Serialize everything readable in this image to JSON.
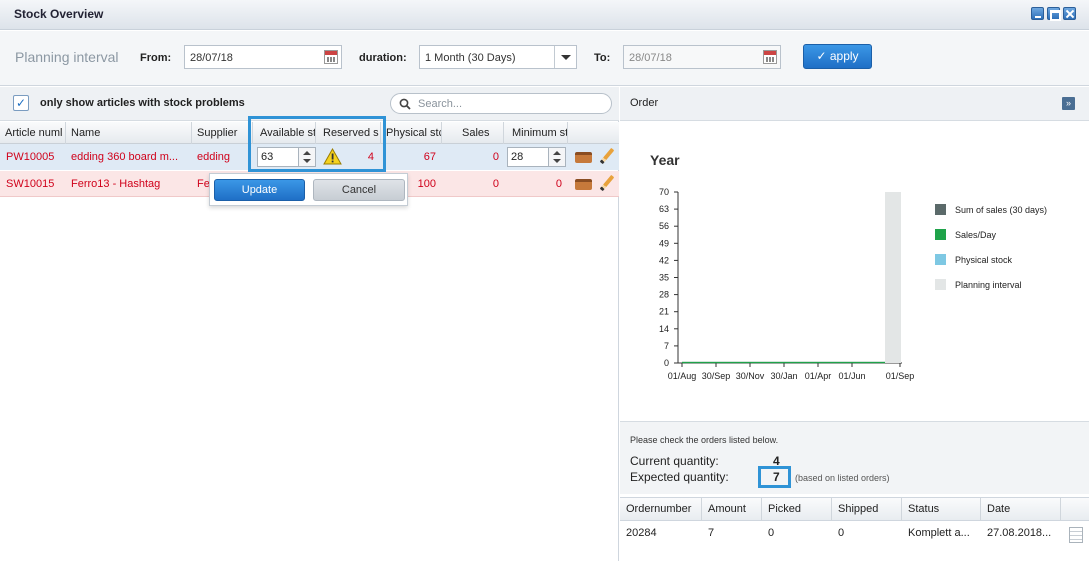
{
  "window": {
    "title": "Stock Overview"
  },
  "planning": {
    "label": "Planning interval",
    "from_label": "From:",
    "from_value": "28/07/18",
    "duration_label": "duration:",
    "duration_value": "1 Month (30 Days)",
    "to_label": "To:",
    "to_value": "28/07/18",
    "apply_label": "✓ apply"
  },
  "filter": {
    "checkbox_label": "only show articles with stock problems",
    "checked": true,
    "search_placeholder": "Search..."
  },
  "grid": {
    "columns": [
      "Article numl",
      "Name",
      "Supplier",
      "Available st",
      "Reserved s",
      "Physical stc",
      "Sales",
      "Minimum st"
    ],
    "rows": [
      {
        "article": "PW10005",
        "name": "edding 360 board m...",
        "supplier": "edding",
        "available": "63",
        "reserved": "4",
        "physical": "67",
        "sales": "0",
        "minimum": "28"
      },
      {
        "article": "SW10015",
        "name": "Ferro13 - Hashtag",
        "supplier": "Fe",
        "available": "",
        "reserved": "",
        "physical": "100",
        "sales": "0",
        "minimum": "0"
      }
    ],
    "update_label": "Update",
    "cancel_label": "Cancel"
  },
  "order_panel": {
    "title": "Order",
    "expand_glyph": "»",
    "chart_title": "Year"
  },
  "chart_data": {
    "type": "bar",
    "title": "Year",
    "xlabel": "",
    "ylabel": "",
    "ylim": [
      0,
      70
    ],
    "yticks": [
      "70",
      "63",
      "56",
      "49",
      "42",
      "35",
      "28",
      "21",
      "14",
      "7",
      "0"
    ],
    "xticks": [
      "01/Aug",
      "30/Sep",
      "30/Nov",
      "30/Jan",
      "01/Apr",
      "01/Jun",
      "01/Sep"
    ],
    "series": [
      {
        "name": "Sum of sales (30 days)",
        "color": "#5b6a6a",
        "values": [
          0,
          0,
          0,
          0,
          0,
          0,
          0
        ]
      },
      {
        "name": "Sales/Day",
        "color": "#1fa34a",
        "values": [
          0,
          0,
          0,
          0,
          0,
          0,
          0
        ]
      },
      {
        "name": "Physical stock",
        "color": "#7ec8e3",
        "values": [
          0,
          0,
          0,
          0,
          0,
          0,
          0
        ]
      },
      {
        "name": "Planning interval",
        "color": "#e3e6e6",
        "values": [
          0,
          0,
          0,
          0,
          0,
          0,
          70
        ]
      }
    ],
    "planning_interval_bar": {
      "x_range": [
        "28/07/18",
        "28/08/18"
      ],
      "value": 70
    },
    "grid": false,
    "legend": "right"
  },
  "order_info": {
    "message": "Please check the orders listed below.",
    "current_label": "Current quantity:",
    "current_value": "4",
    "expected_label": "Expected quantity:",
    "expected_value": "7",
    "expected_note": "(based on listed orders)"
  },
  "orders": {
    "columns": [
      "Ordernumber",
      "Amount",
      "Picked",
      "Shipped",
      "Status",
      "Date"
    ],
    "rows": [
      {
        "ordernumber": "20284",
        "amount": "7",
        "picked": "0",
        "shipped": "0",
        "status": "Komplett a...",
        "date": "27.08.2018..."
      }
    ]
  },
  "colors": {
    "accent": "#2f93d6",
    "error": "#d0021b",
    "button": "#1f6fc6"
  }
}
